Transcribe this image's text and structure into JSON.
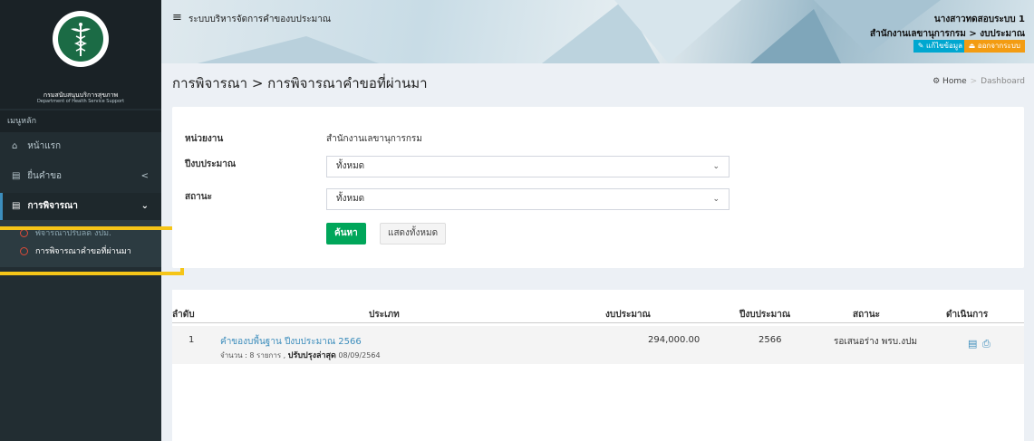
{
  "sidebar": {
    "logo_text_th": "กรมสนับสนุนบริการสุขภาพ",
    "logo_text_en": "Department of Health Service Support",
    "menu_header": "เมนูหลัก",
    "items": [
      {
        "icon": "home-icon",
        "label": "หน้าแรก"
      },
      {
        "icon": "document-icon",
        "label": "ยื่นคำขอ",
        "arrow": "<"
      },
      {
        "icon": "document-icon",
        "label": "การพิจารณา",
        "arrow": "⌄"
      }
    ],
    "subitems": [
      {
        "label": "พิจารณาปรับลด งปม."
      },
      {
        "label": "การพิจารณาคำขอที่ผ่านมา"
      }
    ]
  },
  "topbar": {
    "menu_icon": "hamburger-icon",
    "title": "ระบบบริหารจัดการคำของบประมาณ",
    "user_name": "นางสาวทดสอบระบบ 1",
    "user_dept": "สำนักงานเลขานุการกรม > งบประมาณ",
    "edit_label": "แก้ไขข้อมูล",
    "logout_label": "ออกจากระบบ"
  },
  "header": {
    "page_title": "การพิจารณา > การพิจารณาคำขอที่ผ่านมา",
    "breadcrumb_home": "Home",
    "breadcrumb_sep": ">",
    "breadcrumb_current": "Dashboard"
  },
  "filter": {
    "unit_label": "หน่วยงาน",
    "unit_value": "สำนักงานเลขานุการกรม",
    "year_label": "ปีงบประมาณ",
    "year_value": "ทั้งหมด",
    "status_label": "สถานะ",
    "status_value": "ทั้งหมด",
    "search_button": "ค้นหา",
    "show_all_button": "แสดงทั้งหมด"
  },
  "table": {
    "headers": {
      "no": "ลำดับ",
      "type": "ประเภท",
      "budget": "งบประมาณ",
      "year": "ปีงบประมาณ",
      "status": "สถานะ",
      "action": "ดำเนินการ"
    },
    "rows": [
      {
        "no": "1",
        "type": "คำของบพื้นฐาน ปีงบประมาณ 2566",
        "count_label": "จำนวน : 8 รายการ ,",
        "updated_label": "ปรับปรุงล่าสุด",
        "updated_date": "08/09/2564",
        "budget": "294,000.00",
        "year": "2566",
        "status": "รอเสนอร่าง พรบ.งปม"
      }
    ]
  },
  "colors": {
    "sidebar_bg": "#222d32",
    "search_btn": "#00a65a",
    "link": "#3c8dbc",
    "highlight": "#f5c518",
    "edit_btn": "#00a7d0",
    "logout_btn": "#f39c12"
  }
}
